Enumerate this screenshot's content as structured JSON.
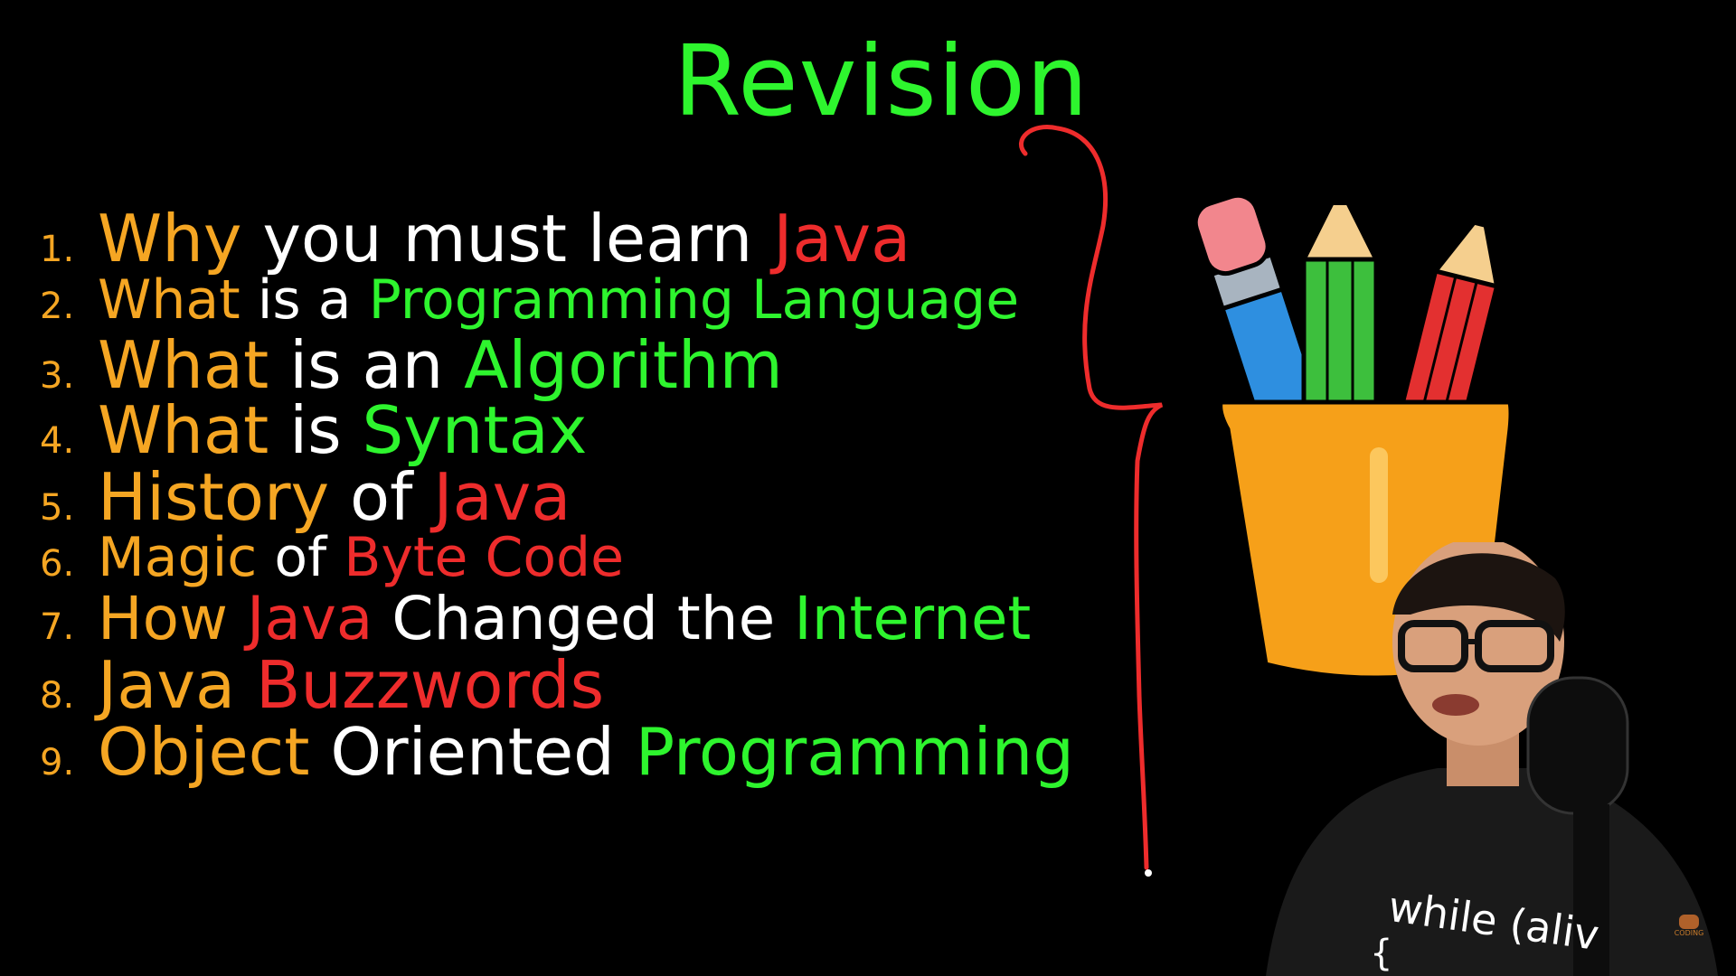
{
  "title": "Revision",
  "items": [
    {
      "num": "1.",
      "size": 72,
      "segments": [
        {
          "text": "Why",
          "color": "orange"
        },
        {
          "text": " you must learn ",
          "color": "white"
        },
        {
          "text": "Java",
          "color": "red"
        }
      ]
    },
    {
      "num": "2.",
      "size": 60,
      "segments": [
        {
          "text": "What",
          "color": "orange"
        },
        {
          "text": " is a ",
          "color": "white"
        },
        {
          "text": "Programming Language",
          "color": "green"
        }
      ]
    },
    {
      "num": "3.",
      "size": 72,
      "segments": [
        {
          "text": "What",
          "color": "orange"
        },
        {
          "text": " is an ",
          "color": "white"
        },
        {
          "text": "Algorithm",
          "color": "green"
        }
      ]
    },
    {
      "num": "4.",
      "size": 72,
      "segments": [
        {
          "text": "What",
          "color": "orange"
        },
        {
          "text": " is ",
          "color": "white"
        },
        {
          "text": "Syntax",
          "color": "green"
        }
      ]
    },
    {
      "num": "5.",
      "size": 72,
      "segments": [
        {
          "text": "History",
          "color": "orange"
        },
        {
          "text": " of ",
          "color": "white"
        },
        {
          "text": "Java",
          "color": "red"
        }
      ]
    },
    {
      "num": "6.",
      "size": 60,
      "segments": [
        {
          "text": "Magic",
          "color": "orange"
        },
        {
          "text": " of ",
          "color": "white"
        },
        {
          "text": "Byte Code",
          "color": "red"
        }
      ]
    },
    {
      "num": "7.",
      "size": 66,
      "segments": [
        {
          "text": "How ",
          "color": "orange"
        },
        {
          "text": "Java",
          "color": "red"
        },
        {
          "text": " Changed the ",
          "color": "white"
        },
        {
          "text": "Internet",
          "color": "green"
        }
      ]
    },
    {
      "num": "8.",
      "size": 72,
      "segments": [
        {
          "text": "Java ",
          "color": "orange"
        },
        {
          "text": "Buzzwords",
          "color": "red"
        }
      ]
    },
    {
      "num": "9.",
      "size": 72,
      "segments": [
        {
          "text": "Object",
          "color": "orange"
        },
        {
          "text": " Oriented ",
          "color": "white"
        },
        {
          "text": "Programming",
          "color": "green"
        }
      ]
    }
  ],
  "shirt_text": "while (aliv",
  "shirt_brace": "{",
  "logo_text": "CODING",
  "colors": {
    "orange": "#f5a623",
    "white": "#ffffff",
    "green": "#2ef52e",
    "red": "#ee2c2c",
    "background": "#000000"
  }
}
